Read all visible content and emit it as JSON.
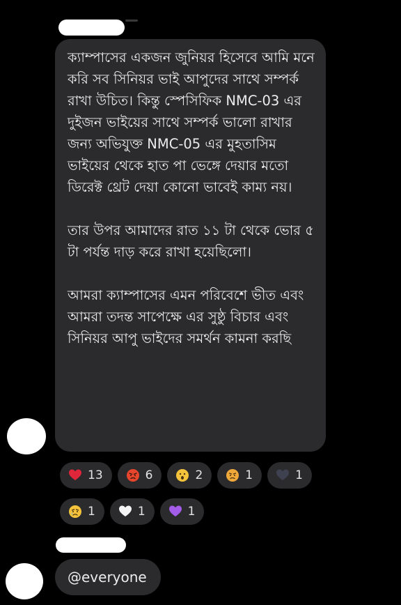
{
  "message": {
    "paragraphs": [
      "ক্যাম্পাসের একজন জুনিয়র হিসেবে আমি মনে করি সব সিনিয়র ভাই আপুদের সাথে সম্পর্ক রাখা উচিত। কিন্তু স্পেসিফিক NMC-03 এর দুইজন ভাইয়ের সাথে সম্পর্ক ভালো রাখার জন্য অভিযুক্ত NMC-05 এর মুহতাসিম ভাইয়ের থেকে হাত পা ভেঙ্গে দেয়ার মতো ডিরেক্ট থ্রেট দেয়া কোনো ভাবেই কাম্য নয়।",
      "তার উপর আমাদের রাত ১১ টা থেকে ভোর ৫ টা পর্যন্ত দাড় করে রাখা হয়েছিলো।",
      "আমরা ক্যাম্পাসের এমন পরিবেশে ভীত এবং আমরা তদন্ত সাপেক্ষে এর সুষ্ঠু বিচার এবং সিনিয়র আপু ভাইদের সমর্থন কামনা করছি"
    ]
  },
  "reactions": [
    {
      "icon": "red-heart-icon",
      "count": "13"
    },
    {
      "icon": "angry-face-icon",
      "count": "6"
    },
    {
      "icon": "surprised-face-icon",
      "count": "2"
    },
    {
      "icon": "frowning-face-icon",
      "count": "1"
    },
    {
      "icon": "black-heart-icon",
      "count": "1"
    },
    {
      "icon": "crying-face-icon",
      "count": "1"
    },
    {
      "icon": "white-heart-icon",
      "count": "1"
    },
    {
      "icon": "purple-heart-icon",
      "count": "1"
    }
  ],
  "reply": {
    "text": "@everyone"
  },
  "colors": {
    "background": "#000000",
    "bubble": "#2b2b2d",
    "text": "#ececec",
    "redact": "#ffffff"
  }
}
